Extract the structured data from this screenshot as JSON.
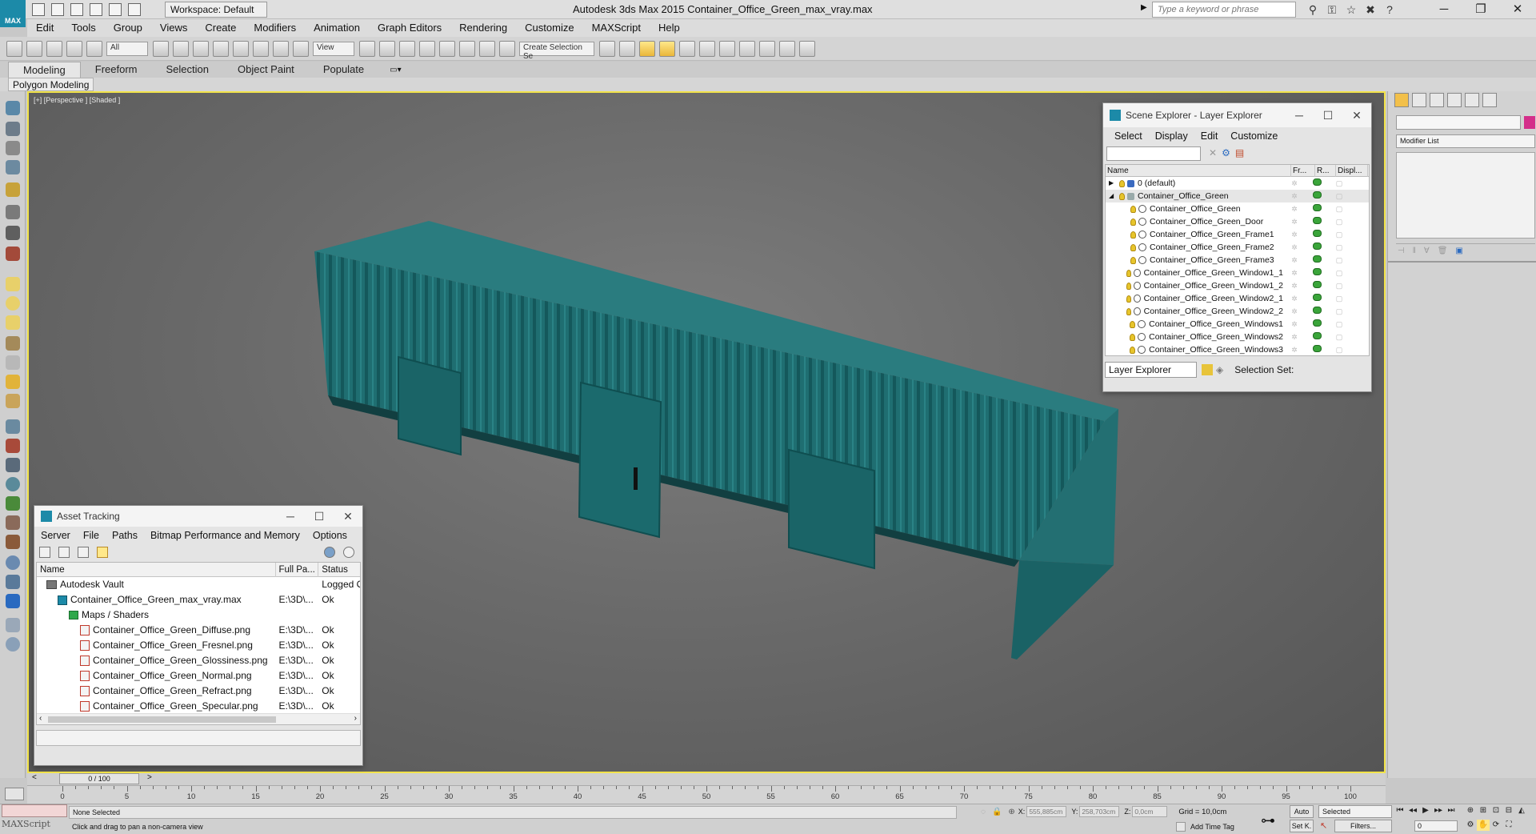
{
  "title_bar": {
    "workspace": "Workspace: Default",
    "window_title": "Autodesk 3ds Max  2015     Container_Office_Green_max_vray.max",
    "search_placeholder": "Type a keyword or phrase",
    "app_label": "MAX"
  },
  "menu": [
    "Edit",
    "Tools",
    "Group",
    "Views",
    "Create",
    "Modifiers",
    "Animation",
    "Graph Editors",
    "Rendering",
    "Customize",
    "MAXScript",
    "Help"
  ],
  "toolbar": {
    "selection_filter": "All",
    "ref_coord": "View",
    "selection_set": "Create Selection Se"
  },
  "ribbon": {
    "tabs": [
      "Modeling",
      "Freeform",
      "Selection",
      "Object Paint",
      "Populate"
    ],
    "active_tab": "Modeling",
    "panel_label": "Polygon Modeling"
  },
  "viewport": {
    "label": "[+] [Perspective ] [Shaded ]",
    "border_color": "#f2e34a",
    "object_color": "#1e6f72"
  },
  "scene_explorer": {
    "title": "Scene Explorer - Layer Explorer",
    "menu": [
      "Select",
      "Display",
      "Edit",
      "Customize"
    ],
    "columns": [
      "Name",
      "Fr...",
      "R...",
      "Displ..."
    ],
    "rows": [
      {
        "name": "0 (default)",
        "level": 0,
        "expander": "▶",
        "type": "layer"
      },
      {
        "name": "Container_Office_Green",
        "level": 0,
        "expander": "◢",
        "type": "layer",
        "selected": true
      },
      {
        "name": "Container_Office_Green",
        "level": 1,
        "type": "object"
      },
      {
        "name": "Container_Office_Green_Door",
        "level": 1,
        "type": "object"
      },
      {
        "name": "Container_Office_Green_Frame1",
        "level": 1,
        "type": "object"
      },
      {
        "name": "Container_Office_Green_Frame2",
        "level": 1,
        "type": "object"
      },
      {
        "name": "Container_Office_Green_Frame3",
        "level": 1,
        "type": "object"
      },
      {
        "name": "Container_Office_Green_Window1_1",
        "level": 1,
        "type": "object"
      },
      {
        "name": "Container_Office_Green_Window1_2",
        "level": 1,
        "type": "object"
      },
      {
        "name": "Container_Office_Green_Window2_1",
        "level": 1,
        "type": "object"
      },
      {
        "name": "Container_Office_Green_Window2_2",
        "level": 1,
        "type": "object"
      },
      {
        "name": "Container_Office_Green_Windows1",
        "level": 1,
        "type": "object"
      },
      {
        "name": "Container_Office_Green_Windows2",
        "level": 1,
        "type": "object"
      },
      {
        "name": "Container_Office_Green_Windows3",
        "level": 1,
        "type": "object"
      }
    ],
    "mode": "Layer Explorer",
    "selection_set_label": "Selection Set:"
  },
  "command_panel": {
    "modifier_list": "Modifier List",
    "object_color": "#d42e8a"
  },
  "asset_tracking": {
    "title": "Asset Tracking",
    "menu": [
      "Server",
      "File",
      "Paths",
      "Bitmap Performance and Memory",
      "Options"
    ],
    "columns": [
      "Name",
      "Full Pa...",
      "Status"
    ],
    "rows": [
      {
        "name": "Autodesk Vault",
        "level": 0,
        "icon": "vault-icon",
        "path": "",
        "status": "Logged O"
      },
      {
        "name": "Container_Office_Green_max_vray.max",
        "level": 1,
        "icon": "max-file-icon",
        "path": "E:\\3D\\...",
        "status": "Ok"
      },
      {
        "name": "Maps / Shaders",
        "level": 2,
        "icon": "folder-icon",
        "path": "",
        "status": ""
      },
      {
        "name": "Container_Office_Green_Diffuse.png",
        "level": 3,
        "icon": "image-file-icon",
        "path": "E:\\3D\\...",
        "status": "Ok"
      },
      {
        "name": "Container_Office_Green_Fresnel.png",
        "level": 3,
        "icon": "image-file-icon",
        "path": "E:\\3D\\...",
        "status": "Ok"
      },
      {
        "name": "Container_Office_Green_Glossiness.png",
        "level": 3,
        "icon": "image-file-icon",
        "path": "E:\\3D\\...",
        "status": "Ok"
      },
      {
        "name": "Container_Office_Green_Normal.png",
        "level": 3,
        "icon": "image-file-icon",
        "path": "E:\\3D\\...",
        "status": "Ok"
      },
      {
        "name": "Container_Office_Green_Refract.png",
        "level": 3,
        "icon": "image-file-icon",
        "path": "E:\\3D\\...",
        "status": "Ok"
      },
      {
        "name": "Container_Office_Green_Specular.png",
        "level": 3,
        "icon": "image-file-icon",
        "path": "E:\\3D\\...",
        "status": "Ok"
      }
    ]
  },
  "timeline": {
    "frame_display": "0 / 100",
    "ticks": [
      0,
      5,
      10,
      15,
      20,
      25,
      30,
      35,
      40,
      45,
      50,
      55,
      60,
      65,
      70,
      75,
      80,
      85,
      90,
      95,
      100
    ],
    "frame_max": 100
  },
  "status_bar": {
    "maxscript_label": "MAXScript",
    "selection": "None Selected",
    "prompt": "Click and drag to pan a non-camera view",
    "x_label": "X:",
    "x_value": "555,885cm",
    "y_label": "Y:",
    "y_value": "258,703cm",
    "z_label": "Z:",
    "z_value": "0,0cm",
    "grid": "Grid = 10,0cm",
    "add_time_tag": "Add Time Tag",
    "auto_key": "Auto",
    "set_key": "Set K.",
    "key_mode": "Selected",
    "filters": "Filters...",
    "current_frame": "0"
  }
}
